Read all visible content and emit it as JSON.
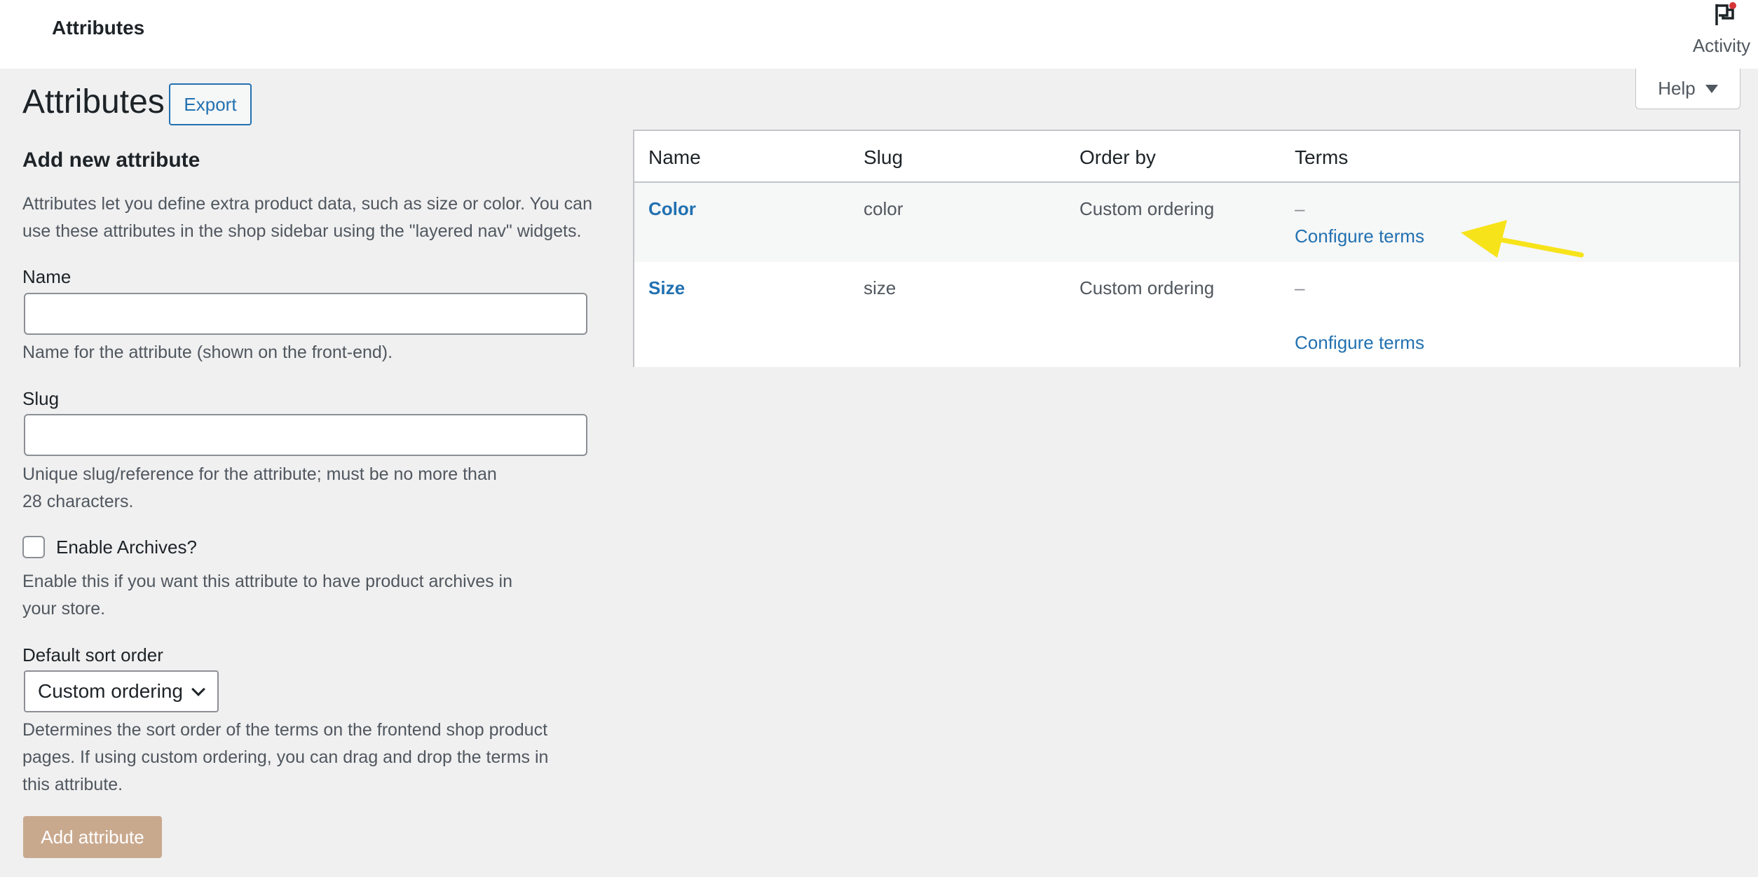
{
  "topbar": {
    "title": "Attributes",
    "activity_label": "Activity"
  },
  "help": {
    "label": "Help"
  },
  "page": {
    "title": "Attributes",
    "export_label": "Export"
  },
  "form": {
    "section_title": "Add new attribute",
    "intro_line1": "Attributes let you define extra product data, such as size or color. You can",
    "intro_line2": "use these attributes in the shop sidebar using the \"layered nav\" widgets.",
    "name_label": "Name",
    "name_value": "",
    "name_help": "Name for the attribute (shown on the front-end).",
    "slug_label": "Slug",
    "slug_value": "",
    "slug_help_line1": "Unique slug/reference for the attribute; must be no more than",
    "slug_help_line2": "28 characters.",
    "archives_label": "Enable Archives?",
    "archives_checked": false,
    "archives_help_line1": "Enable this if you want this attribute to have product archives in",
    "archives_help_line2": "your store.",
    "sort_label": "Default sort order",
    "sort_selected": "Custom ordering",
    "sort_help_line1": "Determines the sort order of the terms on the frontend shop product",
    "sort_help_line2": "pages. If using custom ordering, you can drag and drop the terms in",
    "sort_help_line3": "this attribute.",
    "submit_label": "Add attribute"
  },
  "table": {
    "headers": [
      "Name",
      "Slug",
      "Order by",
      "Terms"
    ],
    "rows": [
      {
        "name": "Color",
        "slug": "color",
        "order_by": "Custom ordering",
        "terms": "–",
        "configure": "Configure terms"
      },
      {
        "name": "Size",
        "slug": "size",
        "order_by": "Custom ordering",
        "terms": "–",
        "configure": "Configure terms"
      }
    ]
  },
  "colors": {
    "accent": "#2271b1",
    "annotation_arrow": "#f7e31a",
    "notification_dot": "#d63638"
  },
  "icons": {
    "activity": "flag-icon",
    "help_caret": "caret-down-icon",
    "select_chevron": "chevron-down-icon"
  }
}
